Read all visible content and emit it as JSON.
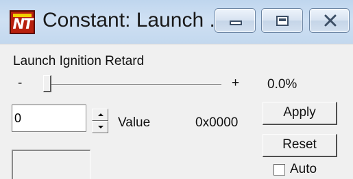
{
  "window": {
    "title": "Constant: Launch ...",
    "logo_text": "NT",
    "logo_icon": "nt-app-logo",
    "minimize_icon": "minimize-icon",
    "maximize_icon": "maximize-icon",
    "close_icon": "close-icon"
  },
  "parameter": {
    "name": "Launch Ignition Retard",
    "slider_min_label": "-",
    "slider_max_label": "+",
    "percent_display": "0.0%",
    "slider_position": 0.0
  },
  "value_field": {
    "value": "0",
    "caption": "Value",
    "hex": "0x0000",
    "spin_up_icon": "spin-up-icon",
    "spin_down_icon": "spin-down-icon"
  },
  "buttons": {
    "apply_label": "Apply",
    "reset_label": "Reset"
  },
  "auto": {
    "label": "Auto",
    "checked": false
  },
  "colors": {
    "titlebar": "#c8dbef",
    "logo_red": "#b8200e",
    "logo_yellow": "#f2d100",
    "face": "#f0f0f0"
  }
}
